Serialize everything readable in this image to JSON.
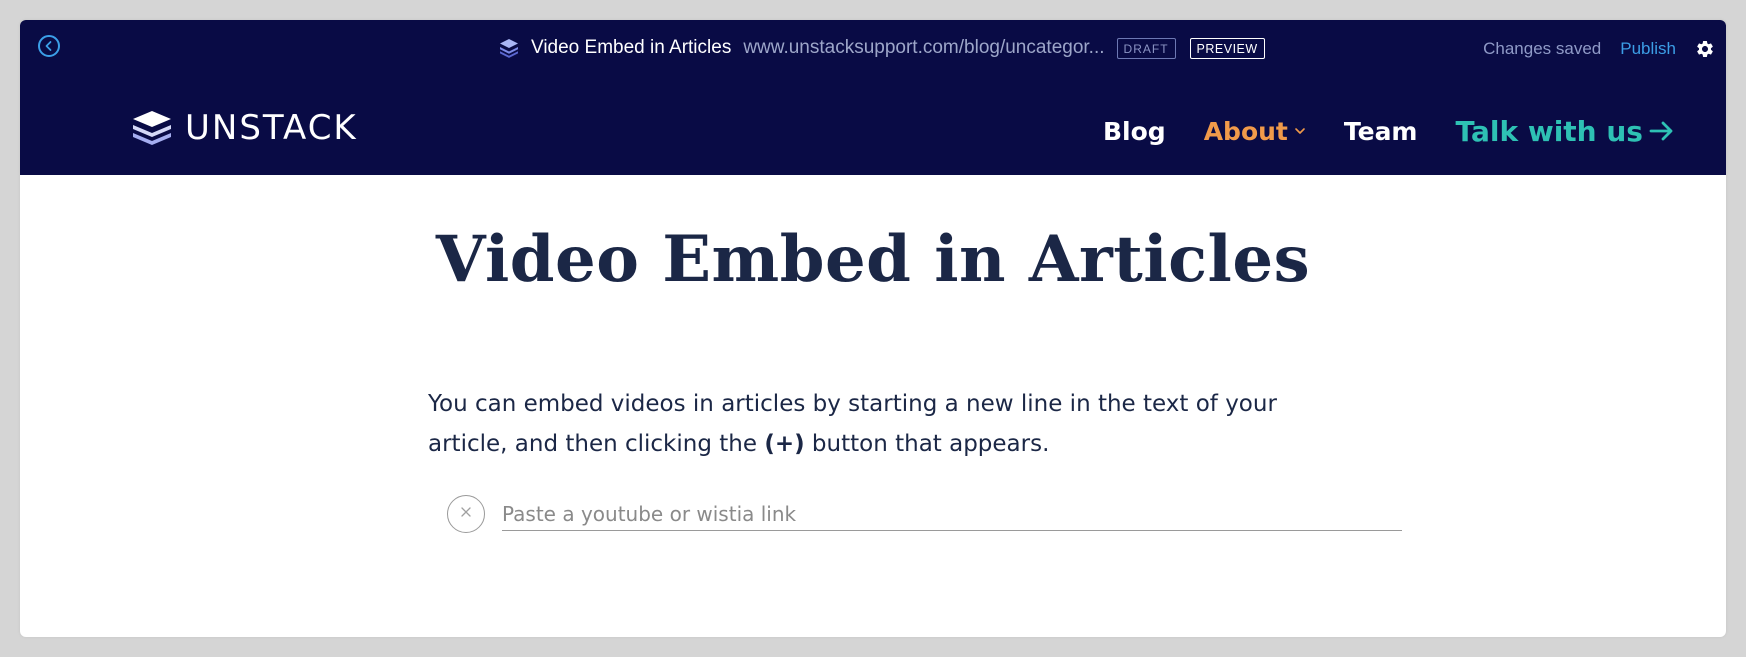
{
  "editor_bar": {
    "page_title": "Video Embed in Articles",
    "page_url": "www.unstacksupport.com/blog/uncategor...",
    "draft_badge": "DRAFT",
    "preview_button": "PREVIEW",
    "status": "Changes saved",
    "publish_label": "Publish",
    "icons": {
      "back": "back-arrow-circle-icon",
      "page": "layers-icon",
      "settings": "gear-icon"
    }
  },
  "site_nav": {
    "logo_text": "UNSTACK",
    "items": [
      {
        "label": "Blog"
      },
      {
        "label": "About",
        "has_dropdown": true,
        "color": "#f09a4a"
      },
      {
        "label": "Team"
      }
    ],
    "cta_label": "Talk with us",
    "cta_color": "#2ec1b4"
  },
  "article": {
    "title": "Video Embed in Articles",
    "body_pre": "You can embed videos in articles by starting a new line in the text of your article, and then clicking the ",
    "body_bold": "(+)",
    "body_post": " button that appears.",
    "embed_placeholder": "Paste a youtube or wistia link",
    "embed_value": ""
  },
  "colors": {
    "header_bg": "#090b45",
    "accent_blue": "#3c9ee6",
    "accent_orange": "#f09a4a",
    "accent_teal": "#2ec1b4",
    "title_text": "#1b2746"
  }
}
